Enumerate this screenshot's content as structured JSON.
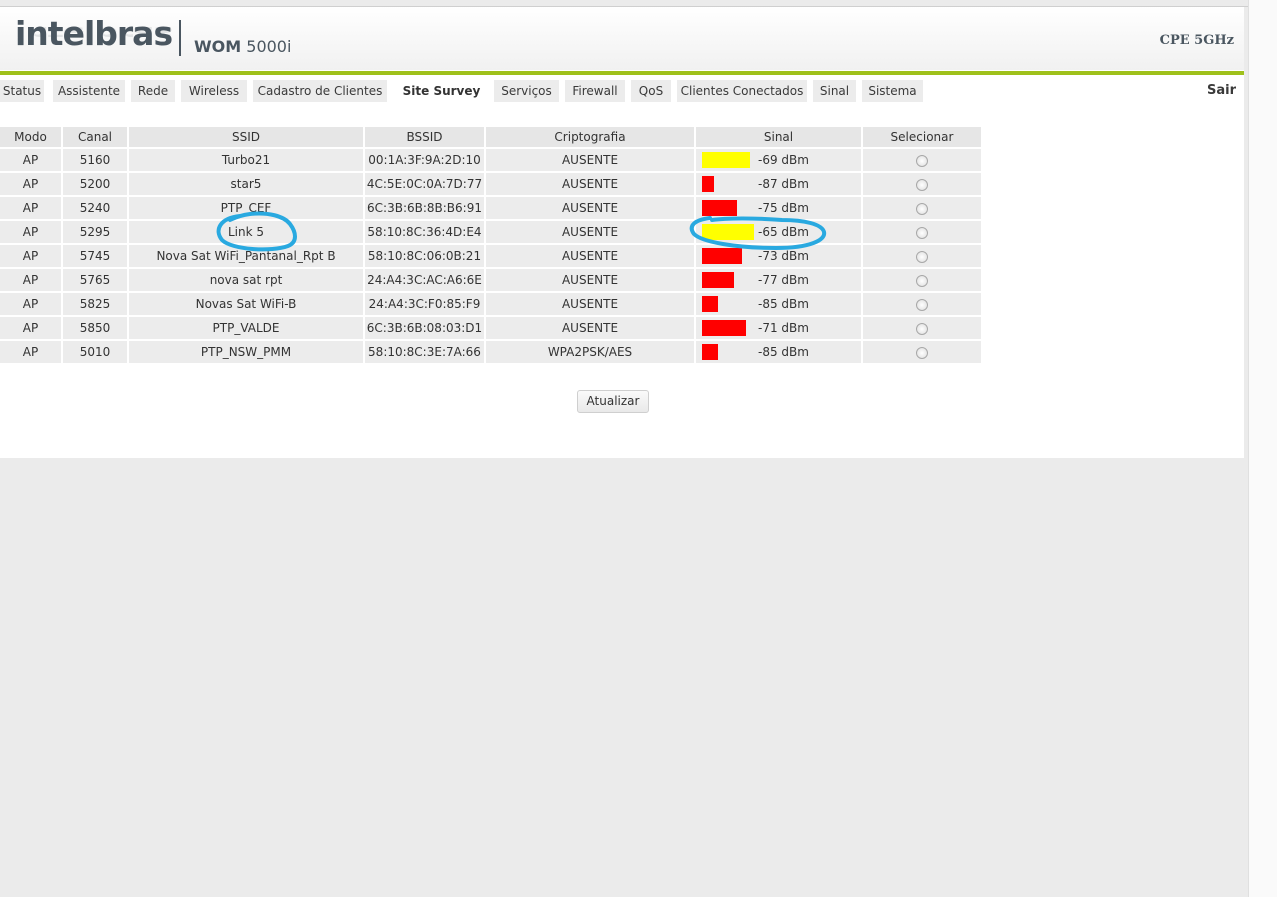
{
  "header": {
    "logo": "intelbras",
    "model_prefix": "WOM",
    "model_number": "5000i",
    "device_type": "CPE 5GHz"
  },
  "tabs": [
    {
      "label": "Status"
    },
    {
      "label": "Assistente"
    },
    {
      "label": "Rede"
    },
    {
      "label": "Wireless"
    },
    {
      "label": "Cadastro de Clientes"
    },
    {
      "label": "Site Survey",
      "active": true
    },
    {
      "label": "Serviços"
    },
    {
      "label": "Firewall"
    },
    {
      "label": "QoS"
    },
    {
      "label": "Clientes Conectados"
    },
    {
      "label": "Sinal"
    },
    {
      "label": "Sistema"
    }
  ],
  "logout_label": "Sair",
  "table": {
    "columns": [
      "Modo",
      "Canal",
      "SSID",
      "BSSID",
      "Criptografia",
      "Sinal",
      "Selecionar"
    ],
    "rows": [
      {
        "mode": "AP",
        "channel": "5160",
        "ssid": "Turbo21",
        "bssid": "00:1A:3F:9A:2D:10",
        "crypto": "AUSENTE",
        "signal": "-69 dBm",
        "bar_level": 0.92,
        "bar_color": "#ffff00"
      },
      {
        "mode": "AP",
        "channel": "5200",
        "ssid": "star5",
        "bssid": "4C:5E:0C:0A:7D:77",
        "crypto": "AUSENTE",
        "signal": "-87 dBm",
        "bar_level": 0.24,
        "bar_color": "#ff0000"
      },
      {
        "mode": "AP",
        "channel": "5240",
        "ssid": "PTP_CEF",
        "bssid": "6C:3B:6B:8B:B6:91",
        "crypto": "AUSENTE",
        "signal": "-75 dBm",
        "bar_level": 0.68,
        "bar_color": "#ff0000"
      },
      {
        "mode": "AP",
        "channel": "5295",
        "ssid": "Link 5",
        "bssid": "58:10:8C:36:4D:E4",
        "crypto": "AUSENTE",
        "signal": "-65 dBm",
        "bar_level": 1.0,
        "bar_color": "#ffff00"
      },
      {
        "mode": "AP",
        "channel": "5745",
        "ssid": "Nova Sat WiFi_Pantanal_Rpt B",
        "bssid": "58:10:8C:06:0B:21",
        "crypto": "AUSENTE",
        "signal": "-73 dBm",
        "bar_level": 0.76,
        "bar_color": "#ff0000"
      },
      {
        "mode": "AP",
        "channel": "5765",
        "ssid": "nova sat rpt",
        "bssid": "24:A4:3C:AC:A6:6E",
        "crypto": "AUSENTE",
        "signal": "-77 dBm",
        "bar_level": 0.62,
        "bar_color": "#ff0000"
      },
      {
        "mode": "AP",
        "channel": "5825",
        "ssid": "Novas Sat WiFi-B",
        "bssid": "24:A4:3C:F0:85:F9",
        "crypto": "AUSENTE",
        "signal": "-85 dBm",
        "bar_level": 0.31,
        "bar_color": "#ff0000"
      },
      {
        "mode": "AP",
        "channel": "5850",
        "ssid": "PTP_VALDE",
        "bssid": "6C:3B:6B:08:03:D1",
        "crypto": "AUSENTE",
        "signal": "-71 dBm",
        "bar_level": 0.84,
        "bar_color": "#ff0000"
      },
      {
        "mode": "AP",
        "channel": "5010",
        "ssid": "PTP_NSW_PMM",
        "bssid": "58:10:8C:3E:7A:66",
        "crypto": "WPA2PSK/AES",
        "signal": "-85 dBm",
        "bar_level": 0.31,
        "bar_color": "#ff0000"
      }
    ]
  },
  "refresh_label": "Atualizar",
  "colors": {
    "accent_green": "#9fc11b",
    "annotation_blue": "#29a9e0"
  }
}
